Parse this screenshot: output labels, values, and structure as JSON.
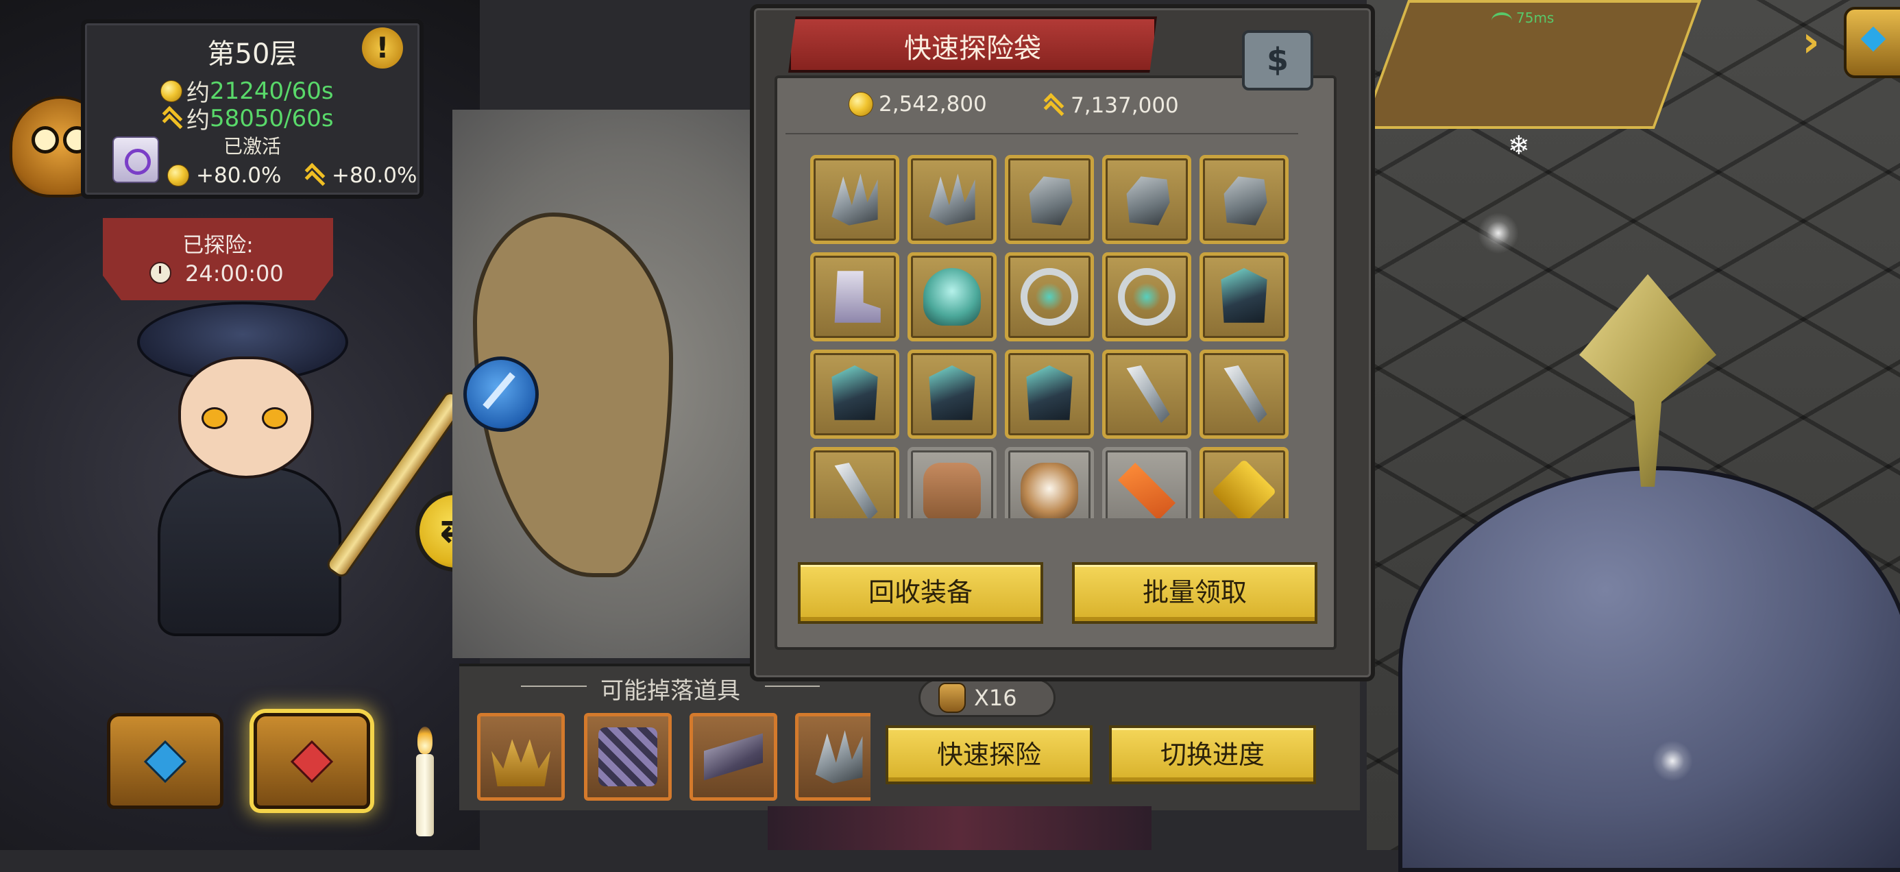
{
  "floor_card": {
    "title": "第50层",
    "gold_rate_prefix": "约",
    "gold_rate": "21240/60s",
    "exp_rate_prefix": "约",
    "exp_rate": "58050/60s",
    "activated_label": "已激活",
    "gold_bonus": "+80.0%",
    "exp_bonus": "+80.0%",
    "warning_icon": "!"
  },
  "explore_status": {
    "label": "已探险:",
    "time": "24:00:00"
  },
  "swap_button_glyph": "⇄",
  "panel": {
    "title": "快速探险袋",
    "corner_icon_glyph": "$",
    "gold_amount": "2,542,800",
    "exp_amount": "7,137,000",
    "items": [
      {
        "icon": "claw-icon"
      },
      {
        "icon": "claw-icon"
      },
      {
        "icon": "gauntlet-icon"
      },
      {
        "icon": "gauntlet-icon"
      },
      {
        "icon": "gauntlet-icon"
      },
      {
        "icon": "boot-icon"
      },
      {
        "icon": "helm-icon"
      },
      {
        "icon": "ring-icon"
      },
      {
        "icon": "ring-icon"
      },
      {
        "icon": "armor-icon"
      },
      {
        "icon": "armor-icon"
      },
      {
        "icon": "armor-icon"
      },
      {
        "icon": "armor-icon"
      },
      {
        "icon": "blade-icon"
      },
      {
        "icon": "blade-icon"
      },
      {
        "icon": "blade-icon"
      },
      {
        "icon": "pelt-icon"
      },
      {
        "icon": "dog-icon"
      },
      {
        "icon": "carrot-icon"
      },
      {
        "icon": "book-icon"
      }
    ],
    "recycle_label": "回收装备",
    "batch_claim_label": "批量领取"
  },
  "drops": {
    "label": "可能掉落道具",
    "items": [
      {
        "icon": "crown-icon"
      },
      {
        "icon": "chain-icon"
      },
      {
        "icon": "bracer-icon"
      },
      {
        "icon": "claw-icon"
      }
    ]
  },
  "bag_count": "X16",
  "quick_explore_label": "快速探险",
  "switch_progress_label": "切换进度",
  "scene": {
    "ping": "75ms",
    "arrow_glyph": "›",
    "snowflake_glyph": "❄"
  },
  "colors": {
    "gold_text": "#59d96a",
    "accent_gold": "#f4d659",
    "ribbon_red": "#b23a36"
  }
}
